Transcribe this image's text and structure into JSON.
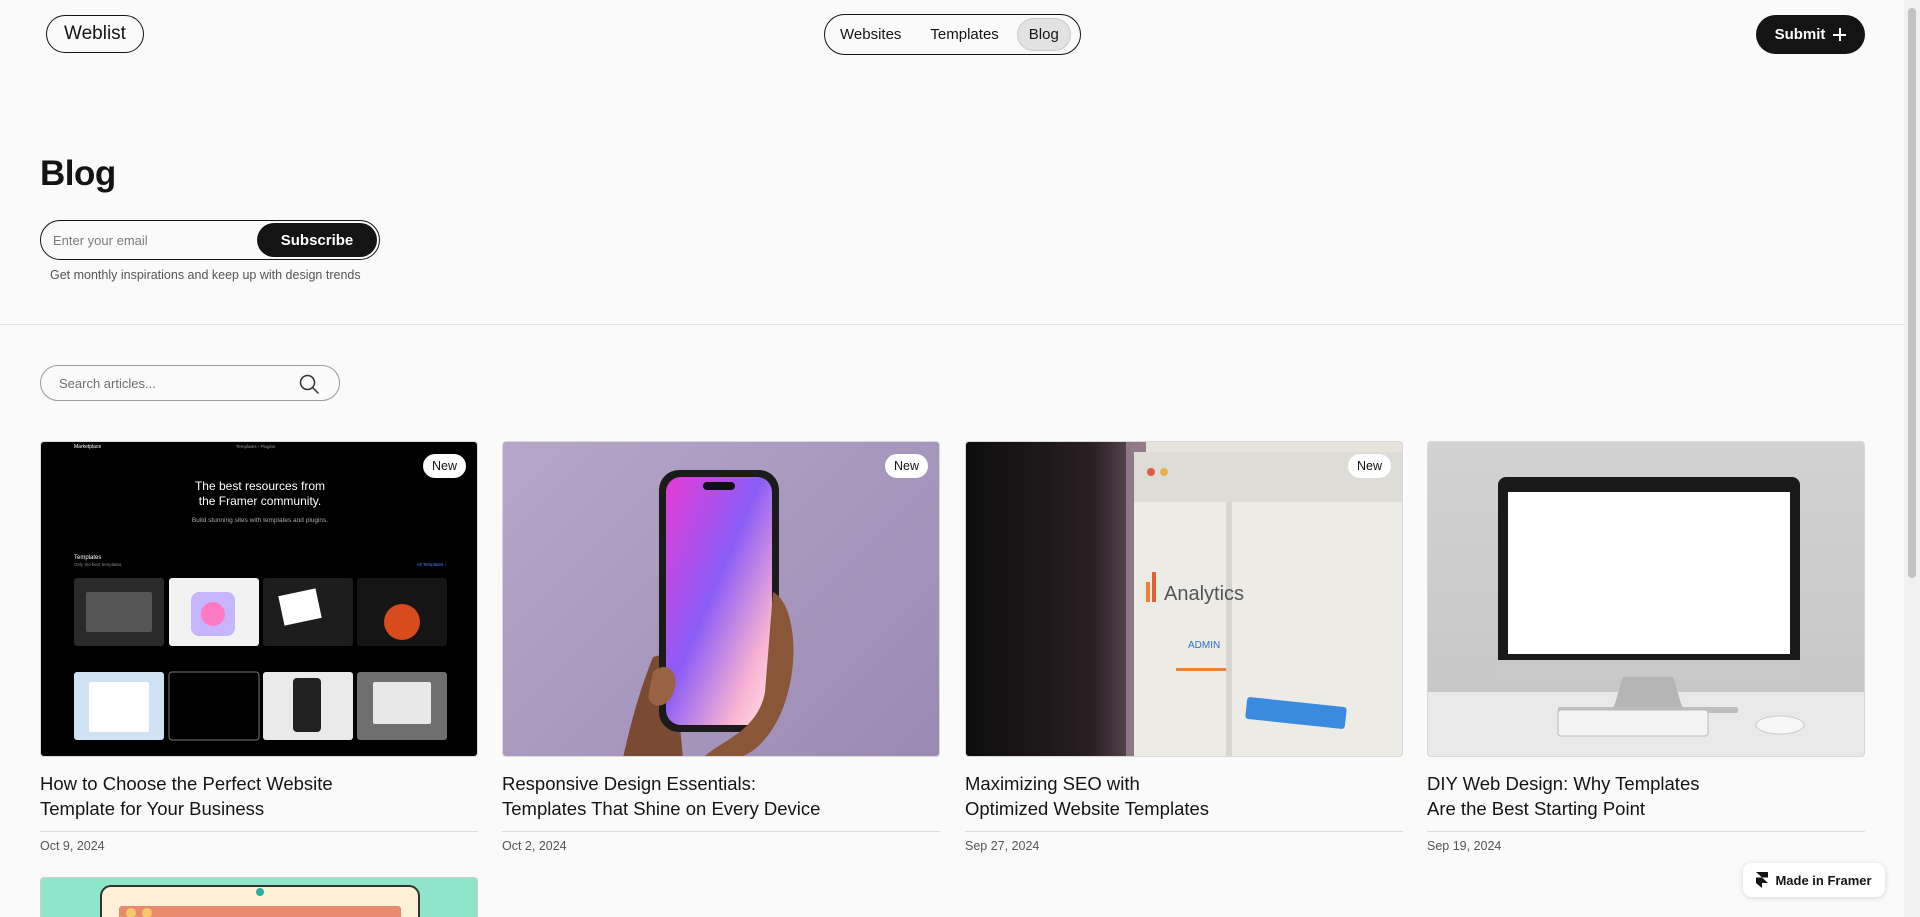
{
  "header": {
    "logo": "Weblist",
    "nav": [
      {
        "label": "Websites",
        "active": false
      },
      {
        "label": "Templates",
        "active": false
      },
      {
        "label": "Blog",
        "active": true
      }
    ],
    "submit_label": "Submit"
  },
  "hero": {
    "title": "Blog",
    "email_placeholder": "Enter your email",
    "subscribe_label": "Subscribe",
    "hint": "Get monthly inspirations and keep up with design trends"
  },
  "search": {
    "placeholder": "Search articles..."
  },
  "cards": [
    {
      "title_line1": "How to Choose the Perfect Website",
      "title_line2": "Template for Your Business",
      "date": "Oct 9, 2024",
      "badge": "New",
      "thumb_text": {
        "nav_brand": "Marketplace",
        "nav_links": "Templates ›   Plugins",
        "headline1": "The best resources from",
        "headline2": "the Framer community.",
        "sub": "Build stunning sites with templates and plugins.",
        "section": "Templates",
        "section_sub": "Only the best templates.",
        "all_link": "All Templates ›"
      }
    },
    {
      "title_line1": "Responsive Design Essentials:",
      "title_line2": "Templates That Shine on Every Device",
      "date": "Oct 2, 2024",
      "badge": "New"
    },
    {
      "title_line1": "Maximizing SEO with",
      "title_line2": "Optimized Website Templates",
      "date": "Sep 27, 2024",
      "badge": "New",
      "thumb_text": {
        "app": "Analytics",
        "tab": "ADMIN"
      }
    },
    {
      "title_line1": "DIY Web Design: Why Templates",
      "title_line2": "Are the Best Starting Point",
      "date": "Sep 19, 2024",
      "badge": ""
    }
  ],
  "framer_badge": "Made in Framer",
  "colors": {
    "background": "#fafafa",
    "primary": "#141414",
    "card5": "#8fe5c9"
  }
}
